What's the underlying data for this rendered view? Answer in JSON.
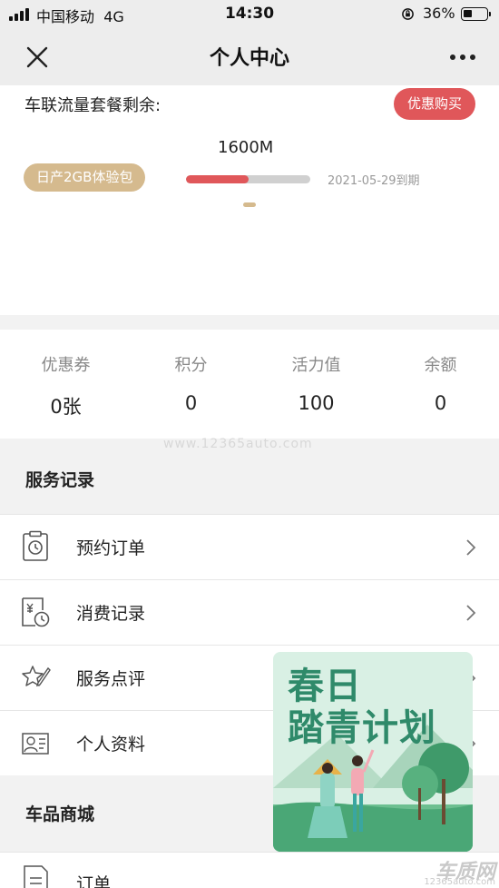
{
  "status_bar": {
    "carrier": "中国移动",
    "network": "4G",
    "time": "14:30",
    "battery": "36%"
  },
  "nav": {
    "title": "个人中心"
  },
  "plan": {
    "heading": "车联流量套餐剩余:",
    "buy_label": "优惠购买",
    "amount": "1600M",
    "name": "日产2GB体验包",
    "expiry": "2021-05-29到期",
    "usage_fraction": 0.5,
    "accent_color": "#e0575a",
    "badge_color": "#d5ba8e"
  },
  "stats": [
    {
      "label": "优惠券",
      "value": "0张"
    },
    {
      "label": "积分",
      "value": "0"
    },
    {
      "label": "活力值",
      "value": "100"
    },
    {
      "label": "余额",
      "value": "0"
    }
  ],
  "watermark": "www.12365auto.com",
  "service_section": {
    "title": "服务记录",
    "items": [
      {
        "label": "预约订单",
        "icon": "clock-clipboard-icon"
      },
      {
        "label": "消费记录",
        "icon": "receipt-clock-icon"
      },
      {
        "label": "服务点评",
        "icon": "star-pen-icon"
      },
      {
        "label": "个人资料",
        "icon": "id-card-icon"
      }
    ]
  },
  "shop_section": {
    "title": "车品商城",
    "items": [
      {
        "label": "订单",
        "icon": "document-icon"
      }
    ]
  },
  "promo": {
    "line1": "春日",
    "line2": "踏青计划"
  },
  "logo": {
    "main": "车质网",
    "sub": "12365auto.com"
  }
}
